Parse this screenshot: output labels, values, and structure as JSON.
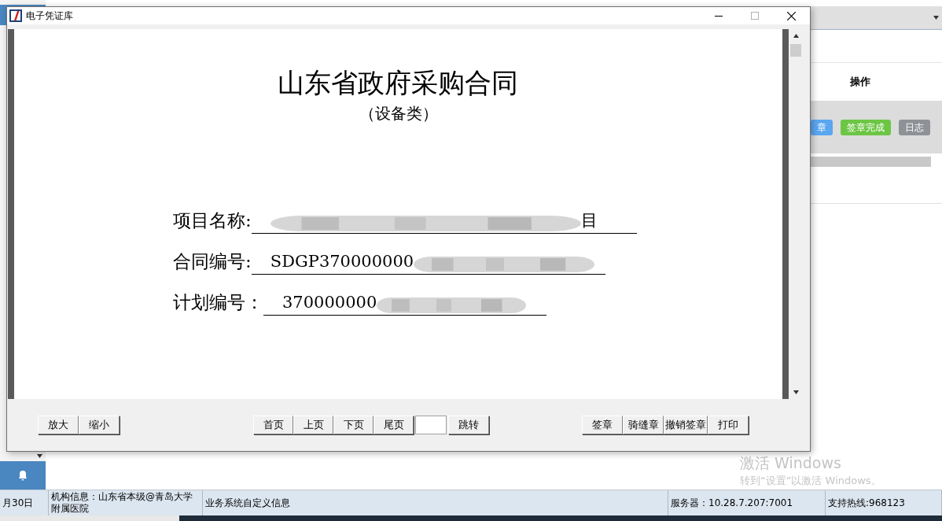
{
  "background_app": {
    "action_header": "操作",
    "row_buttons": [
      {
        "label": "章",
        "color": "#5aa6f0"
      },
      {
        "label": "签章完成",
        "color": "#6cc644"
      },
      {
        "label": "日志",
        "color": "#8e9196"
      }
    ],
    "status_bar": [
      "月30日",
      "机构信息：山东省本级@青岛大学附属医院",
      "业务系统自定义信息",
      "服务器：10.28.7.207:7001",
      "支持热线:968123"
    ]
  },
  "window": {
    "title": "电子凭证库"
  },
  "document": {
    "title": "山东省政府采购合同",
    "subtitle": "（设备类）",
    "fields": [
      {
        "label": "项目名称:",
        "tail": "目"
      },
      {
        "label": "合同编号:",
        "value": "SDGP370000000"
      },
      {
        "label": "计划编号：",
        "value": "370000000"
      }
    ]
  },
  "toolbar": {
    "zoom_buttons": [
      "放大",
      "缩小"
    ],
    "page_buttons": [
      "首页",
      "上页",
      "下页",
      "尾页"
    ],
    "jump_button": "跳转",
    "action_buttons": [
      "签章",
      "骑缝章",
      "撤销签章",
      "打印"
    ]
  },
  "activation_notice": {
    "title": "激活 Windows",
    "text": "转到“设置”以激活 Windows。"
  }
}
